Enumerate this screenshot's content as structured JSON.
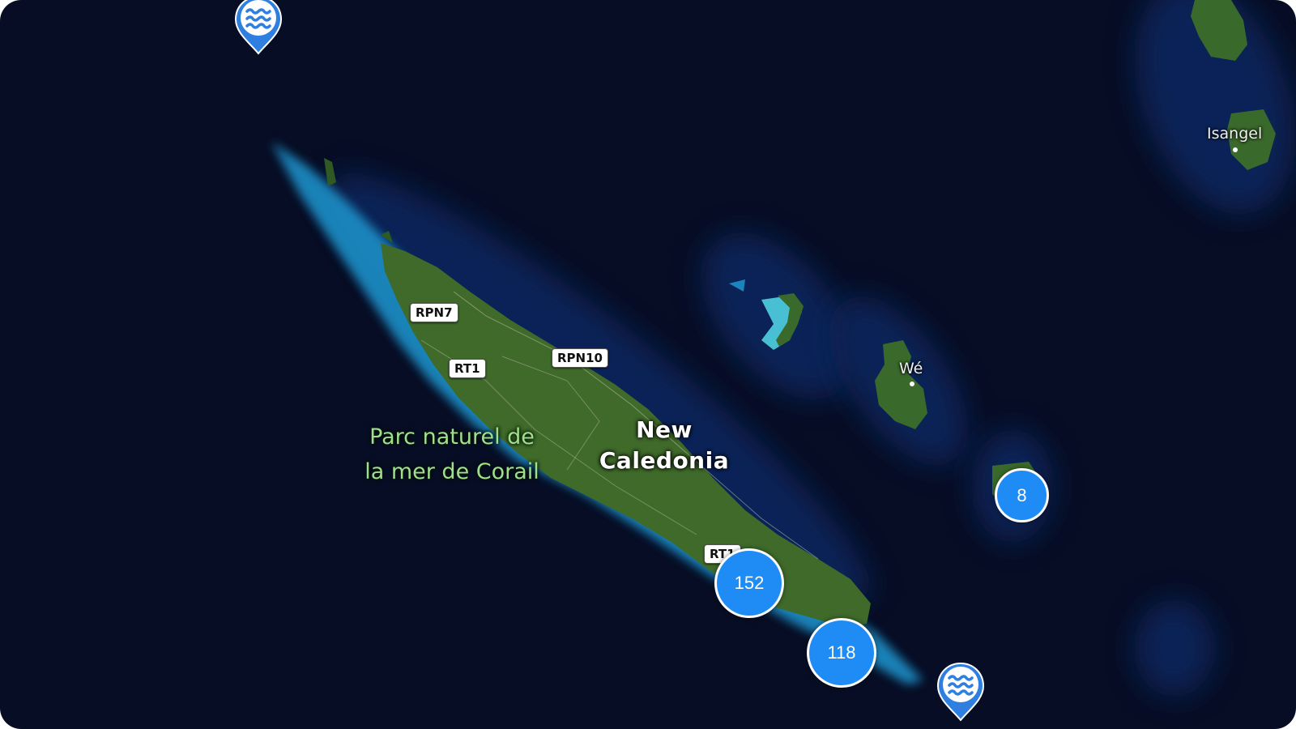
{
  "map": {
    "country_label_line1": "New",
    "country_label_line2": "Caledonia",
    "park_label_line1": "Parc naturel de",
    "park_label_line2": "la mer de Corail",
    "places": [
      {
        "name": "Wé"
      },
      {
        "name": "Isangel"
      }
    ],
    "road_shields": [
      {
        "label": "RPN7"
      },
      {
        "label": "RT1"
      },
      {
        "label": "RPN10"
      },
      {
        "label": "RT1"
      }
    ],
    "clusters": [
      {
        "count": "152"
      },
      {
        "count": "118"
      },
      {
        "count": "8"
      }
    ],
    "markers": [
      {
        "icon": "water-waves-icon",
        "color": "#2f7fe0"
      },
      {
        "icon": "water-waves-icon",
        "color": "#2f7fe0"
      }
    ],
    "colors": {
      "ocean": "#070d24",
      "cluster_fill": "#1f8cf5",
      "park_label": "#9fe08c",
      "land": "#3f6a2a",
      "reef": "#27a9d6"
    }
  }
}
